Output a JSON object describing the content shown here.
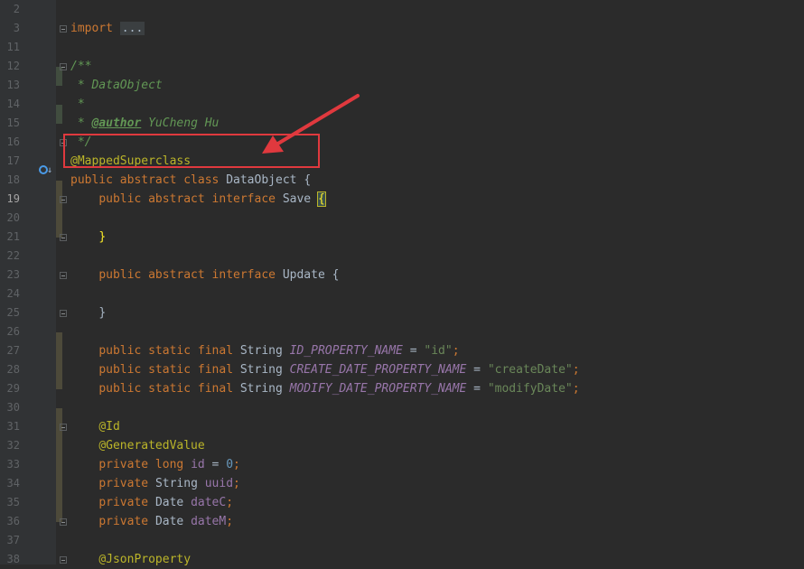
{
  "editor": {
    "current_line": "19",
    "lines": [
      {
        "n": "2",
        "t": ""
      },
      {
        "n": "3",
        "import_kw": "import",
        "import_fold": "..."
      },
      {
        "n": "11",
        "t": ""
      },
      {
        "n": "12",
        "c": "/**"
      },
      {
        "n": "13",
        "c": " * DataObject"
      },
      {
        "n": "14",
        "c": " *"
      },
      {
        "n": "15",
        "c_prefix": " * ",
        "tag": "@author",
        "c_suffix": " YuCheng Hu"
      },
      {
        "n": "16",
        "c": " */"
      },
      {
        "n": "17",
        "ann": "@MappedSuperclass"
      },
      {
        "n": "18",
        "kw": "public abstract class",
        "name": "DataObject",
        "brace": "{"
      },
      {
        "n": "19",
        "indent": "    ",
        "kw": "public abstract interface",
        "name": "Save",
        "brace": "{"
      },
      {
        "n": "20",
        "t": ""
      },
      {
        "n": "21",
        "indent": "    ",
        "brace": "}"
      },
      {
        "n": "22",
        "t": ""
      },
      {
        "n": "23",
        "indent": "    ",
        "kw": "public abstract interface",
        "name": "Update",
        "brace": "{"
      },
      {
        "n": "24",
        "t": ""
      },
      {
        "n": "25",
        "indent": "    ",
        "brace": "}"
      },
      {
        "n": "26",
        "t": ""
      },
      {
        "n": "27",
        "indent": "    ",
        "kw": "public static final",
        "type": "String",
        "const": "ID_PROPERTY_NAME",
        "eq": " = ",
        "str": "\"id\"",
        "end": ";"
      },
      {
        "n": "28",
        "indent": "    ",
        "kw": "public static final",
        "type": "String",
        "const": "CREATE_DATE_PROPERTY_NAME",
        "eq": " = ",
        "str": "\"createDate\"",
        "end": ";"
      },
      {
        "n": "29",
        "indent": "    ",
        "kw": "public static final",
        "type": "String",
        "const": "MODIFY_DATE_PROPERTY_NAME",
        "eq": " = ",
        "str": "\"modifyDate\"",
        "end": ";"
      },
      {
        "n": "30",
        "t": ""
      },
      {
        "n": "31",
        "indent": "    ",
        "ann": "@Id"
      },
      {
        "n": "32",
        "indent": "    ",
        "ann": "@GeneratedValue"
      },
      {
        "n": "33",
        "indent": "    ",
        "kw": "private long",
        "field": "id",
        "eq": " = ",
        "num": "0",
        "end": ";"
      },
      {
        "n": "34",
        "indent": "    ",
        "kw": "private",
        "type": "String",
        "field": "uuid",
        "end": ";"
      },
      {
        "n": "35",
        "indent": "    ",
        "kw": "private",
        "type": "Date",
        "field": "dateC",
        "end": ";"
      },
      {
        "n": "36",
        "indent": "    ",
        "kw": "private",
        "type": "Date",
        "field": "dateM",
        "end": ";"
      },
      {
        "n": "37",
        "t": ""
      },
      {
        "n": "38",
        "indent": "    ",
        "ann": "@JsonProperty"
      }
    ]
  },
  "annotation_overlay": {
    "box_color": "#e0393e",
    "arrow_color": "#e0393e"
  }
}
